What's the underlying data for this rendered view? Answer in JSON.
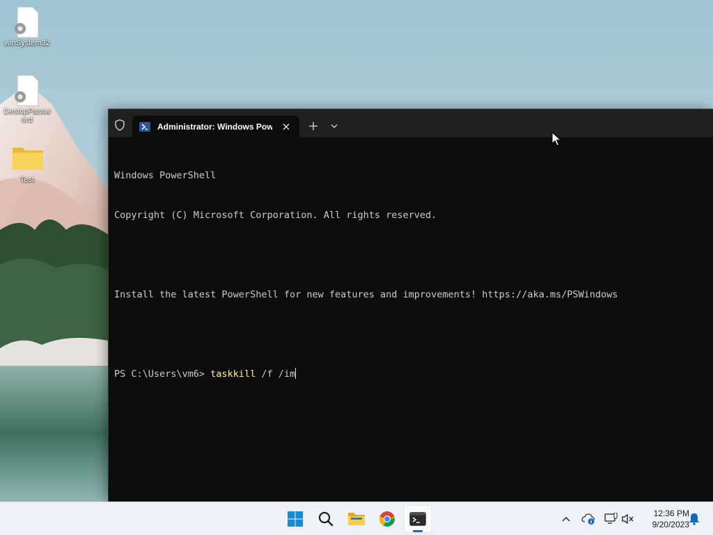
{
  "desktop": {
    "icons": [
      {
        "name": "winSystem32",
        "type": "file-settings"
      },
      {
        "name": "DestopPassword",
        "type": "file-settings"
      },
      {
        "name": "Test",
        "type": "folder"
      }
    ]
  },
  "terminal": {
    "tab_title": "Administrator: Windows PowerShell",
    "lines": [
      "Windows PowerShell",
      "Copyright (C) Microsoft Corporation. All rights reserved.",
      "",
      "Install the latest PowerShell for new features and improvements! https://aka.ms/PSWindows",
      ""
    ],
    "prompt": "PS C:\\Users\\vm6> ",
    "command": "taskkill",
    "args": " /f /im"
  },
  "taskbar": {
    "apps": [
      {
        "name": "start",
        "icon": "windows-logo-icon"
      },
      {
        "name": "search",
        "icon": "search-icon"
      },
      {
        "name": "file-explorer",
        "icon": "folder-icon"
      },
      {
        "name": "chrome",
        "icon": "chrome-icon"
      },
      {
        "name": "terminal",
        "icon": "terminal-icon",
        "active": true
      }
    ],
    "clock": {
      "time": "12:36 PM",
      "date": "9/20/2023"
    }
  },
  "colors": {
    "terminal_bg": "#0c0c0c",
    "titlebar_bg": "#202020",
    "command_text": "#f9f1a5",
    "accent": "#0f6cbd"
  }
}
